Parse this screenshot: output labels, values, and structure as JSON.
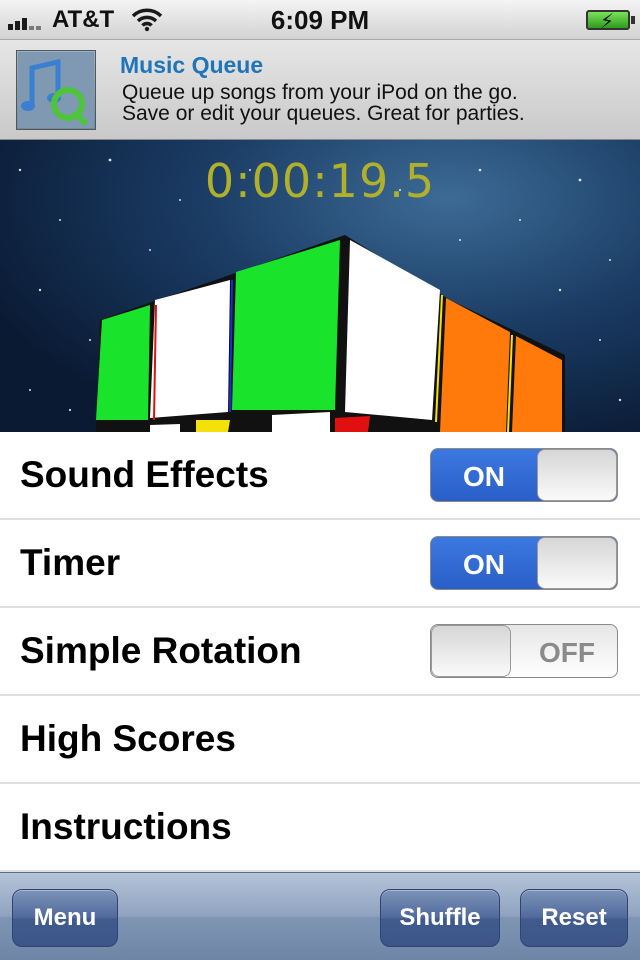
{
  "status_bar": {
    "carrier": "AT&T",
    "time": "6:09 PM",
    "battery": "charging"
  },
  "ad": {
    "title": "Music Queue",
    "line1": "Queue up songs from your iPod on the go.",
    "line2": "Save or edit your queues. Great for parties."
  },
  "game": {
    "timer": "0:00:19.5"
  },
  "settings": {
    "sound_effects": {
      "label": "Sound Effects",
      "state": "ON"
    },
    "timer": {
      "label": "Timer",
      "state": "ON"
    },
    "simple_rotation": {
      "label": "Simple Rotation",
      "state": "OFF"
    },
    "high_scores": {
      "label": "High Scores"
    },
    "instructions": {
      "label": "Instructions"
    }
  },
  "toolbar": {
    "menu": "Menu",
    "shuffle": "Shuffle",
    "reset": "Reset"
  },
  "colors": {
    "toggle_on": "#2a5fc8",
    "timer_text": "#b0b02b",
    "ad_title": "#1f75b7",
    "toolbar": "#7f95b4"
  }
}
